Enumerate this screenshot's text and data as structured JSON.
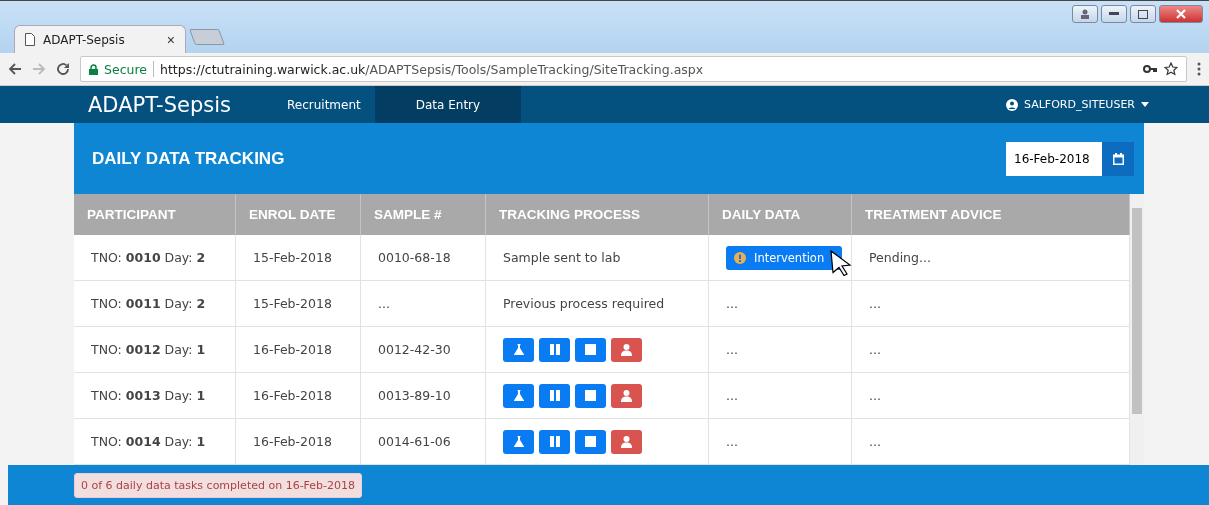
{
  "browser": {
    "tab": {
      "title": "ADAPT-Sepsis",
      "close": "×"
    },
    "address": {
      "secure_label": "Secure",
      "url_host": "https://ctutraining.warwick.ac.uk",
      "url_path": "/ADAPTSepsis/Tools/SampleTracking/SiteTracking.aspx"
    }
  },
  "navbar": {
    "brand": "ADAPT-Sepsis",
    "items": [
      {
        "label": "Recruitment",
        "selected": false
      },
      {
        "label": "Data Entry",
        "selected": true
      }
    ],
    "user": "SALFORD_SITEUSER"
  },
  "panel": {
    "title": "DAILY DATA TRACKING",
    "date": "16-Feb-2018"
  },
  "table": {
    "columns": [
      "PARTICIPANT",
      "ENROL DATE",
      "SAMPLE #",
      "TRACKING PROCESS",
      "DAILY DATA",
      "TREATMENT ADVICE"
    ],
    "rows": [
      {
        "participant": "TNO: **0010** Day: **2**",
        "enrol_date": "15-Feb-2018",
        "sample": "0010-68-18",
        "tracking": {
          "kind": "text",
          "text": "Sample sent to lab"
        },
        "daily_data": {
          "kind": "button",
          "text": "Intervention"
        },
        "treatment": "Pending..."
      },
      {
        "participant": "TNO: **0011** Day: **2**",
        "enrol_date": "15-Feb-2018",
        "sample": "...",
        "tracking": {
          "kind": "text",
          "text": "Previous process required"
        },
        "daily_data": {
          "kind": "text",
          "text": "..."
        },
        "treatment": "..."
      },
      {
        "participant": "TNO: **0012** Day: **1**",
        "enrol_date": "16-Feb-2018",
        "sample": "0012-42-30",
        "tracking": {
          "kind": "actions"
        },
        "daily_data": {
          "kind": "text",
          "text": "..."
        },
        "treatment": "..."
      },
      {
        "participant": "TNO: **0013** Day: **1**",
        "enrol_date": "16-Feb-2018",
        "sample": "0013-89-10",
        "tracking": {
          "kind": "actions"
        },
        "daily_data": {
          "kind": "text",
          "text": "..."
        },
        "treatment": "..."
      },
      {
        "participant": "TNO: **0014** Day: **1**",
        "enrol_date": "16-Feb-2018",
        "sample": "0014-61-06",
        "tracking": {
          "kind": "actions"
        },
        "daily_data": {
          "kind": "text",
          "text": "..."
        },
        "treatment": "..."
      }
    ]
  },
  "footer": {
    "status": "0 of 6 daily data tasks completed on 16-Feb-2018"
  }
}
